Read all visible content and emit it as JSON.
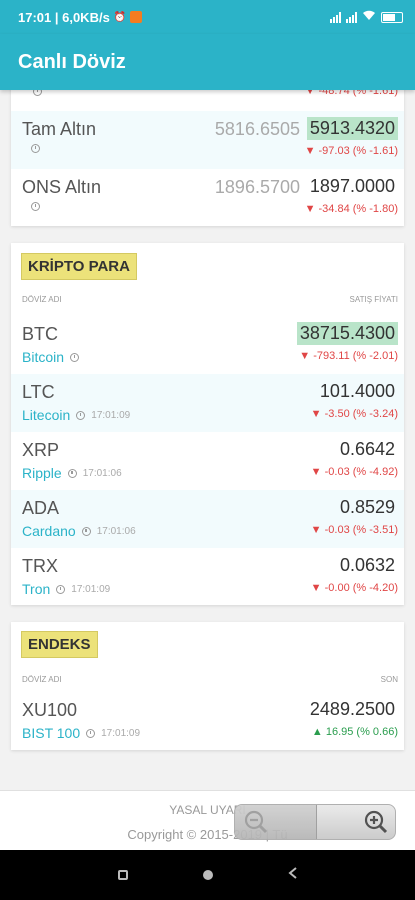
{
  "status": {
    "time_net": "17:01 | 6,0KB/s",
    "alarm": "⏰",
    "battery": ""
  },
  "app": {
    "title": "Canlı Döviz"
  },
  "gold": {
    "partial_change": "▼ -48.74 (% -1.61)",
    "rows": [
      {
        "name": "Tam Altın",
        "buy": "5816.6505",
        "sell": "5913.4320",
        "change": "-97.03 (% -1.61)"
      },
      {
        "name": "ONS Altın",
        "buy": "1896.5700",
        "sell": "1897.0000",
        "change": "-34.84 (% -1.80)"
      }
    ]
  },
  "crypto": {
    "title": "KRİPTO PARA",
    "col_name": "DÖVİZ ADI",
    "col_sell": "SATIŞ FİYATI",
    "rows": [
      {
        "code": "BTC",
        "name": "Bitcoin",
        "time": "",
        "value": "38715.4300",
        "change": "-793.11 (% -2.01)"
      },
      {
        "code": "LTC",
        "name": "Litecoin",
        "time": "17:01:09",
        "value": "101.4000",
        "change": "-3.50 (% -3.24)"
      },
      {
        "code": "XRP",
        "name": "Ripple",
        "time": "17:01:06",
        "value": "0.6642",
        "change": "-0.03 (% -4.92)"
      },
      {
        "code": "ADA",
        "name": "Cardano",
        "time": "17:01:06",
        "value": "0.8529",
        "change": "-0.03 (% -3.51)"
      },
      {
        "code": "TRX",
        "name": "Tron",
        "time": "17:01:09",
        "value": "0.0632",
        "change": "-0.00 (% -4.20)"
      }
    ]
  },
  "index": {
    "title": "ENDEKS",
    "col_name": "DÖVİZ ADI",
    "col_last": "SON",
    "rows": [
      {
        "code": "XU100",
        "name": "BIST 100",
        "time": "17:01:09",
        "value": "2489.2500",
        "change": "16.95 (% 0.66)"
      }
    ]
  },
  "footer": {
    "legal": "YASAL UYARI",
    "copy": "Copyright © 2015-2019 | Tü"
  },
  "colors": {
    "accent": "#2bb3c8",
    "down": "#e04646",
    "up": "#2a9d4e",
    "highlight": "#b9e4c9",
    "badge": "#ece27a"
  }
}
